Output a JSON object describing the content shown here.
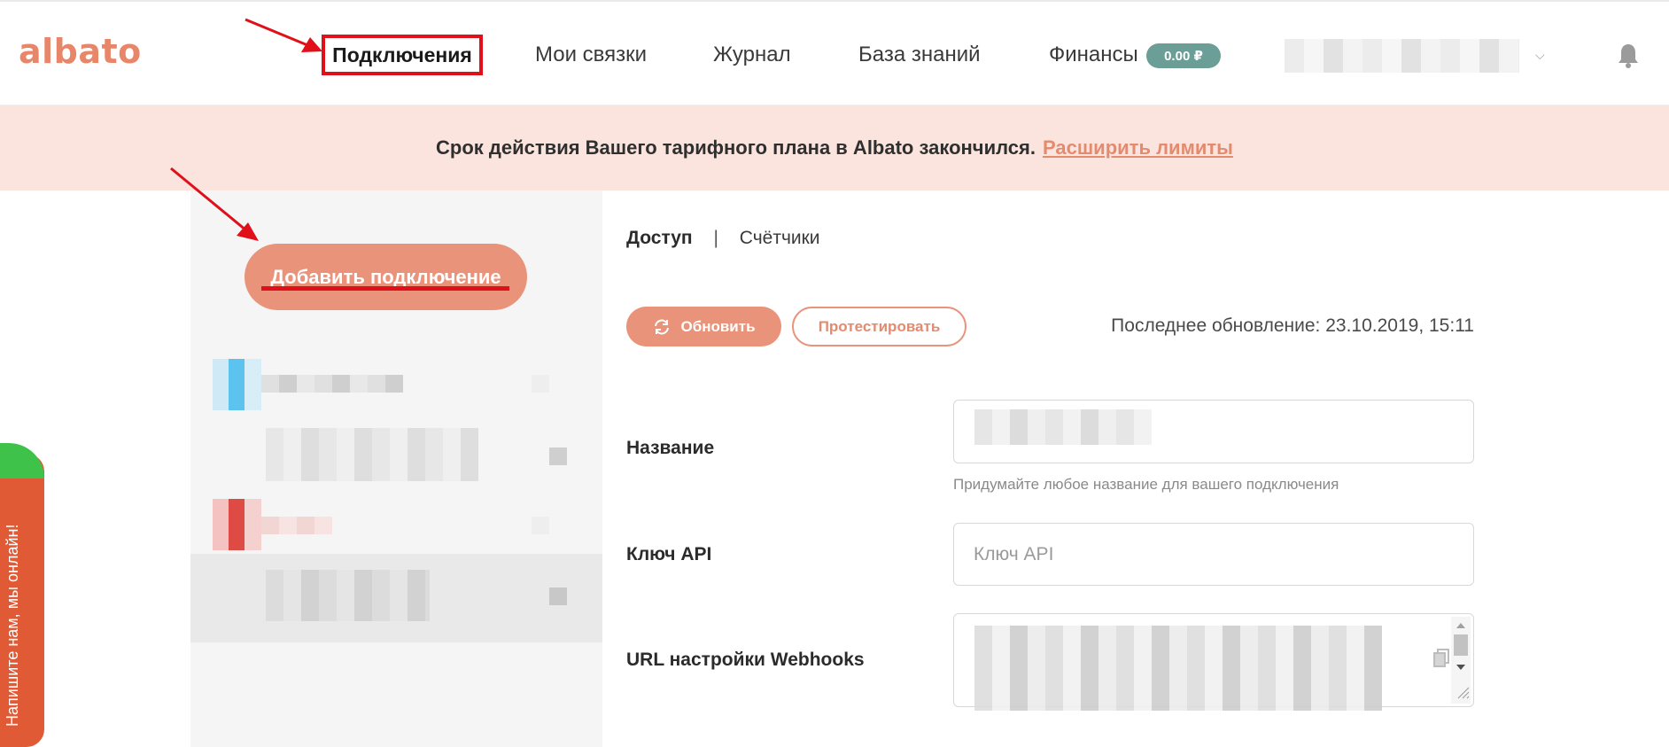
{
  "header": {
    "logo": "albato",
    "nav": {
      "connections": "Подключения",
      "my_links": "Мои связки",
      "journal": "Журнал",
      "knowledge_base": "База знаний",
      "finances": "Финансы"
    },
    "balance": "0.00 ₽",
    "icons": {
      "user_menu": "chevron-down-icon",
      "notifications": "bell-icon"
    }
  },
  "banner": {
    "text": "Срок действия Вашего тарифного плана в Albato закончился.",
    "link": "Расширить лимиты"
  },
  "sidebar": {
    "add_button": "Добавить подключение"
  },
  "chat": {
    "label": "Напишите нам, мы онлайн!"
  },
  "main": {
    "tabs": {
      "access": "Доступ",
      "separator": "|",
      "counters": "Счётчики"
    },
    "buttons": {
      "refresh": "Обновить",
      "test": "Протестировать"
    },
    "last_update": "Последнее обновление: 23.10.2019, 15:11",
    "fields": {
      "name_label": "Название",
      "name_hint": "Придумайте любое название для вашего подключения",
      "api_key_label": "Ключ API",
      "api_key_placeholder": "Ключ API",
      "webhooks_label": "URL настройки Webhooks"
    }
  },
  "colors": {
    "brand": "#e8866a",
    "button_fill": "#e9937a",
    "banner_bg": "#fbe4dd",
    "badge_bg": "#6a9e97",
    "annotation_red": "#e0101a",
    "chat_bg": "#e05a36"
  }
}
